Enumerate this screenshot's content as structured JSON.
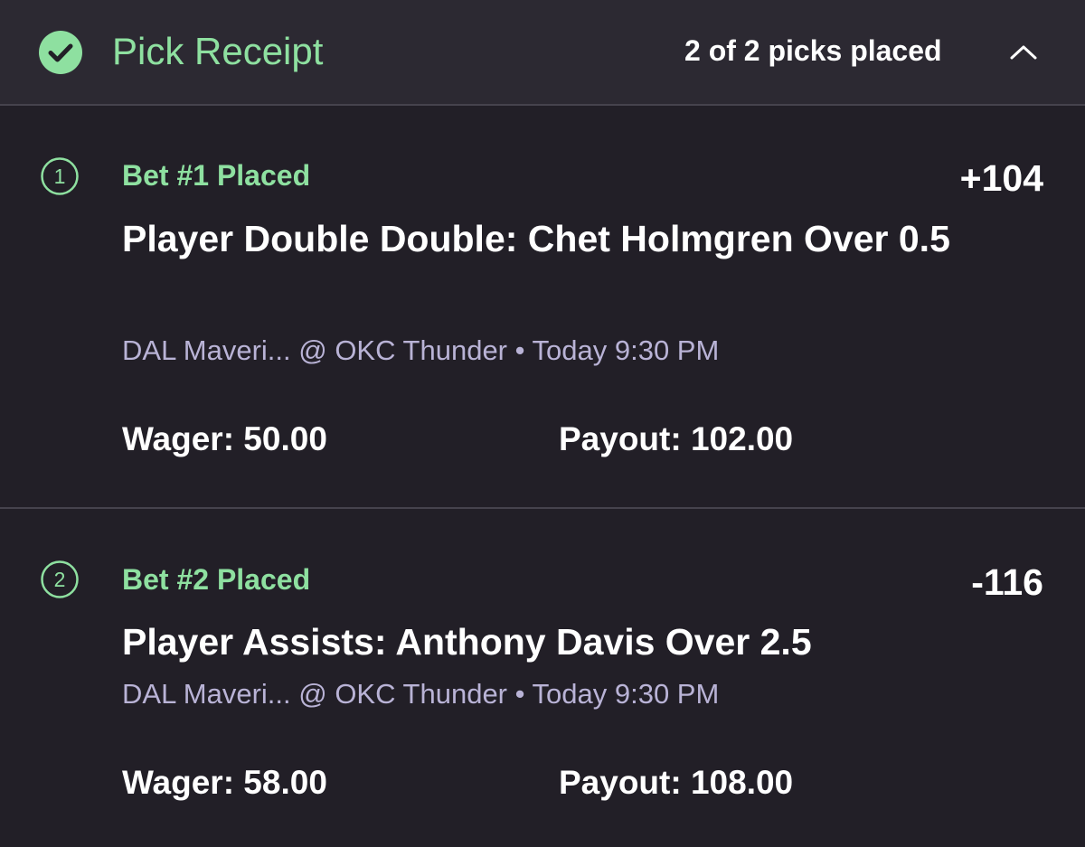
{
  "header": {
    "title": "Pick Receipt",
    "status": "2 of 2 picks placed",
    "check_icon": "check-circle-icon",
    "collapse_icon": "chevron-up-icon"
  },
  "colors": {
    "background": "#221f27",
    "header_background": "#2c2932",
    "accent_green": "#8ee0a0",
    "muted_text": "#b9b3d6",
    "divider": "#46434d"
  },
  "bets": [
    {
      "number": "1",
      "status": "Bet #1 Placed",
      "odds": "+104",
      "title": "Player Double Double: Chet Holmgren Over 0.5",
      "matchup": "DAL Maveri... @ OKC Thunder • Today 9:30 PM",
      "wager": "Wager: 50.00",
      "payout": "Payout: 102.00"
    },
    {
      "number": "2",
      "status": "Bet #2 Placed",
      "odds": "-116",
      "title": "Player Assists: Anthony Davis Over 2.5",
      "matchup": "DAL Maveri... @ OKC Thunder • Today 9:30 PM",
      "wager": "Wager: 58.00",
      "payout": "Payout: 108.00"
    }
  ]
}
